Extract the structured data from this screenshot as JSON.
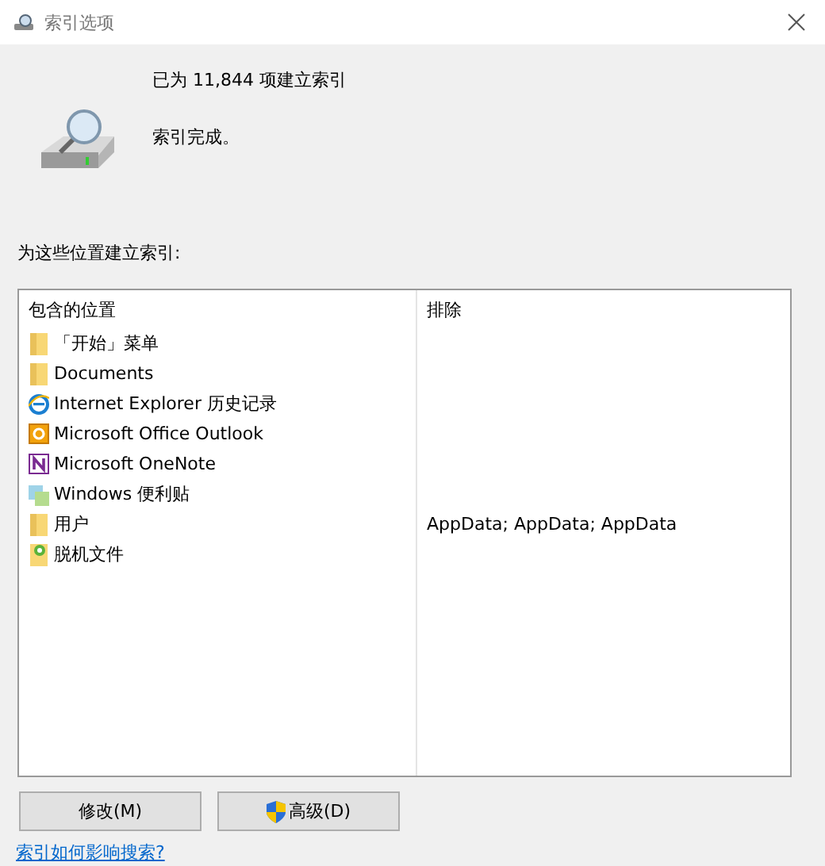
{
  "window": {
    "title": "索引选项"
  },
  "status": {
    "count_text": "已为 11,844 项建立索引",
    "state_text": "索引完成。"
  },
  "locations_label": "为这些位置建立索引:",
  "table": {
    "columns": [
      "包含的位置",
      "排除"
    ],
    "rows": [
      {
        "kind": "folder",
        "location": "「开始」菜单"
      },
      {
        "kind": "folder",
        "location": "Documents"
      },
      {
        "kind": "ie",
        "location": "Internet Explorer 历史记录"
      },
      {
        "kind": "outlook",
        "location": "Microsoft Office Outlook"
      },
      {
        "kind": "onenote",
        "location": "Microsoft OneNote"
      },
      {
        "kind": "sticky",
        "location": "Windows 便利贴"
      },
      {
        "kind": "folder",
        "location": "用户",
        "exclude": "AppData; AppData; AppData"
      },
      {
        "kind": "offline",
        "location": "脱机文件"
      }
    ]
  },
  "buttons": [
    {
      "label": "修改(M)",
      "shield": false
    },
    {
      "label": "高级(D)",
      "shield": true
    }
  ],
  "help_link": "索引如何影响搜索?"
}
